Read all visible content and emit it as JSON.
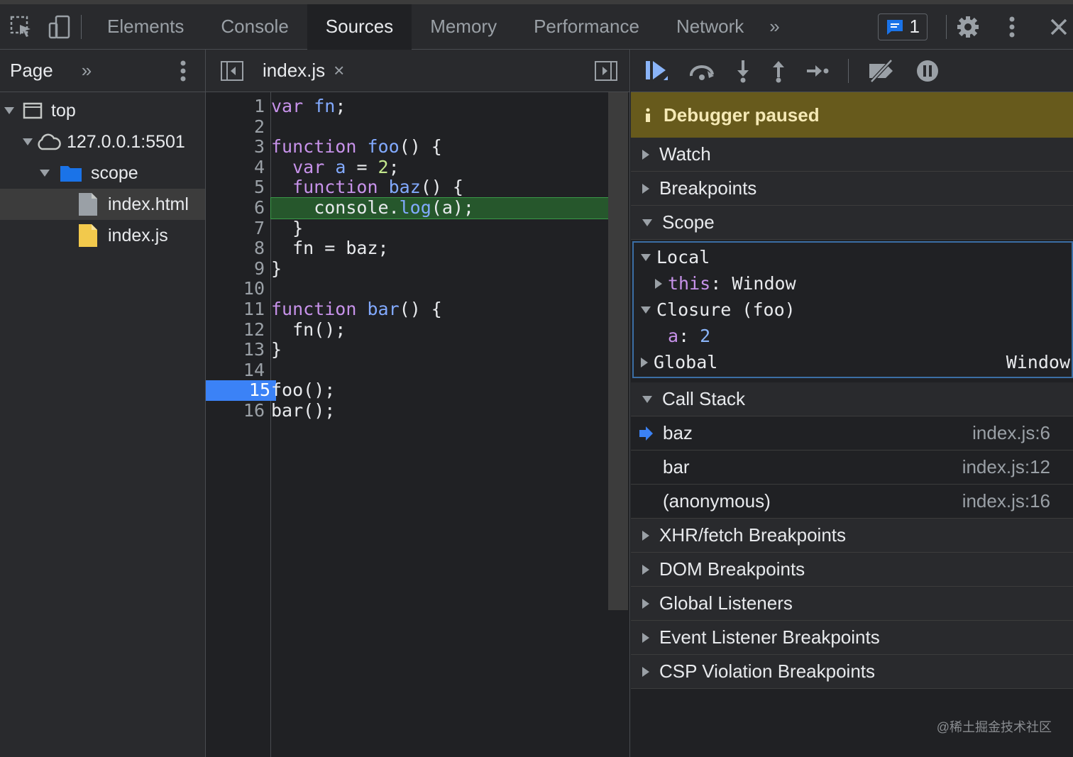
{
  "toolbar": {
    "tabs": [
      "Elements",
      "Console",
      "Sources",
      "Memory",
      "Performance",
      "Network"
    ],
    "more": "»",
    "issues_count": "1"
  },
  "navigator": {
    "tab": "Page",
    "more": "»",
    "tree": [
      "top",
      "127.0.0.1:5501",
      "scope",
      "index.html",
      "index.js"
    ]
  },
  "editor": {
    "file_tab": "index.js",
    "close": "×",
    "line_numbers": [
      "1",
      "2",
      "3",
      "4",
      "5",
      "6",
      "7",
      "8",
      "9",
      "10",
      "11",
      "12",
      "13",
      "14",
      "15",
      "16"
    ],
    "breakpoint_line": "15",
    "current_line": "6"
  },
  "debugger": {
    "paused_text": "Debugger paused",
    "sections_top": [
      "Watch",
      "Breakpoints",
      "Scope"
    ],
    "scope": {
      "local": "Local",
      "this_key": "this",
      "this_val": "Window",
      "closure": "Closure (foo)",
      "a_key": "a",
      "a_val": "2",
      "global": "Global",
      "global_val": "Window"
    },
    "call_stack_title": "Call Stack",
    "call_stack": [
      {
        "fn": "baz",
        "loc": "index.js:6"
      },
      {
        "fn": "bar",
        "loc": "index.js:12"
      },
      {
        "fn": "(anonymous)",
        "loc": "index.js:16"
      }
    ],
    "sections_bottom": [
      "XHR/fetch Breakpoints",
      "DOM Breakpoints",
      "Global Listeners",
      "Event Listener Breakpoints",
      "CSP Violation Breakpoints"
    ]
  },
  "watermark": "@稀土掘金技术社区",
  "colors": {
    "breakpoint": "#3b82f6",
    "current_line": "#26572c",
    "paused_banner": "#675a1c"
  }
}
